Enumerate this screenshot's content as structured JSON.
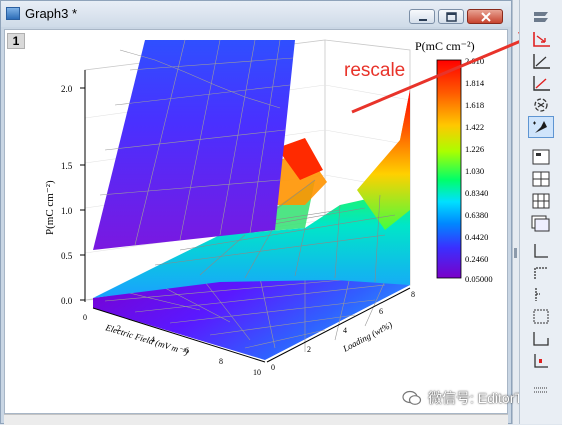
{
  "window": {
    "title": "Graph3 *",
    "layer_label": "1"
  },
  "colorbar": {
    "title": "P(mC cm⁻²)",
    "ticks": [
      "2.010",
      "1.814",
      "1.618",
      "1.422",
      "1.226",
      "1.030",
      "0.8340",
      "0.6380",
      "0.4420",
      "0.2460",
      "0.05000"
    ],
    "colors": [
      "#ff0000",
      "#ff4a00",
      "#ff9400",
      "#ffd800",
      "#d4ff00",
      "#55ff00",
      "#00ff6a",
      "#00e6ff",
      "#0088ff",
      "#2a3cff",
      "#5e00e6",
      "#7a00c8"
    ]
  },
  "axes": {
    "z_label": "P(mC cm⁻²)",
    "z_ticks": [
      "0.0",
      "0.5",
      "1.0",
      "1.5",
      "2.0"
    ],
    "x_label": "Electric Field (mV m⁻¹)",
    "x_ticks": [
      "0",
      "2",
      "4",
      "6",
      "8",
      "10"
    ],
    "y_label": "Loading (wt%)",
    "y_ticks": [
      "0",
      "2",
      "4",
      "6",
      "8"
    ]
  },
  "annotation": {
    "text": "rescale",
    "color": "#e8332a"
  },
  "watermark": {
    "text": "微信号: EditorTan"
  },
  "toolbar": {
    "items": [
      "layer-icon",
      "rescale-icon",
      "axis-icon",
      "axis-red-icon",
      "rotate-icon",
      "sparkle-tool-icon",
      "layout-1-icon",
      "layout-grid-icon",
      "layout-grid2-icon",
      "layout-multi-icon",
      "axis-bottom-icon",
      "axis-top-icon",
      "axis-left-icon",
      "axis-box-icon",
      "axis-corner-icon",
      "axis-marker-icon"
    ]
  }
}
